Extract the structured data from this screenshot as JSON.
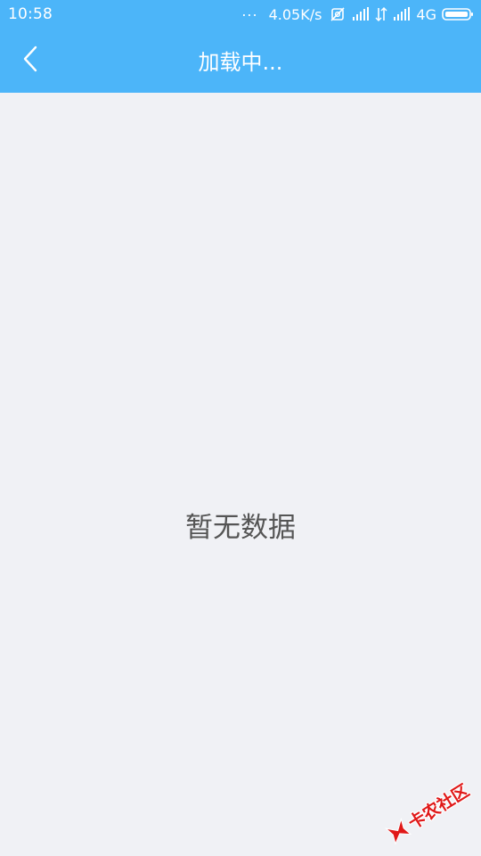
{
  "status_bar": {
    "time": "10:58",
    "dots": "...",
    "speed": "4.05K/s",
    "network": "4G",
    "icons": [
      "mute-icon",
      "signal-icon",
      "data-transfer-icon",
      "signal-icon",
      "battery-icon"
    ]
  },
  "navbar": {
    "title": "加载中...",
    "back_icon": "chevron-left-icon"
  },
  "main": {
    "empty_message": "暂无数据"
  },
  "watermark": {
    "text": "卡农社区",
    "logo_icon": "kanong-logo-icon"
  },
  "colors": {
    "primary": "#4cb5f9",
    "background": "#f0f1f5",
    "empty_text": "#555555",
    "watermark": "#e01818"
  }
}
